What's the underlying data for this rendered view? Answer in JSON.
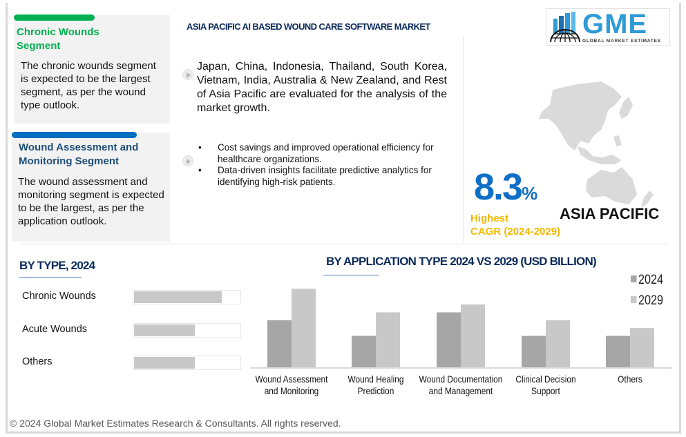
{
  "header": {
    "title": "ASIA PACIFIC AI BASED WOUND CARE SOFTWARE MARKET",
    "logo": {
      "main": "GME",
      "sub": "GLOBAL MARKET ESTIMATES",
      "icon": "globe-buildings-icon"
    }
  },
  "segments": [
    {
      "title": "Chronic Wounds Segment",
      "text": "The chronic wounds segment is expected to be the largest segment, as per the wound type outlook.",
      "accent": "#00b050"
    },
    {
      "title": "Wound Assessment and Monitoring Segment",
      "text": "The wound assessment and monitoring segment is expected to be the largest, as per the application outlook.",
      "accent": "#0070c0"
    }
  ],
  "countries_text": "Japan, China, Indonesia, Thailand, South Korea, Vietnam, India, Australia & New Zealand, and Rest of Asia Pacific are evaluated for the analysis of the market growth.",
  "drivers": [
    "Cost savings and improved operational efficiency for healthcare organizations.",
    "Data-driven insights facilitate predictive analytics for identifying high-risk patients."
  ],
  "cagr": {
    "value": "8.3",
    "unit": "%",
    "label_line1": "Highest",
    "label_line2": "CAGR (2024-2029)",
    "region": "ASIA PACIFIC",
    "color": "#0f6fc6",
    "label_color": "#f5b800"
  },
  "chart_data": [
    {
      "type": "bar",
      "orientation": "horizontal",
      "title": "BY TYPE, 2024",
      "categories": [
        "Chronic Wounds",
        "Acute Wounds",
        "Others"
      ],
      "values": [
        82,
        57,
        57
      ],
      "unit": "relative share (%, estimated from bar fill)",
      "xlim": [
        0,
        100
      ],
      "grid": false
    },
    {
      "type": "bar",
      "title": "BY APPLICATION TYPE 2024 VS 2029 (USD BILLION)",
      "categories": [
        "Wound Assessment and Monitoring",
        "Wound Healing Prediction",
        "Wound Documentation and Management",
        "Clinical Decision Support",
        "Others"
      ],
      "series": [
        {
          "name": "2024",
          "color": "#a6a6a6",
          "values": [
            6,
            4,
            7,
            4,
            4
          ]
        },
        {
          "name": "2029",
          "color": "#c8c8c8",
          "values": [
            10,
            7,
            8,
            6,
            5
          ]
        }
      ],
      "xlabel": "",
      "ylabel": "",
      "ylim": [
        0,
        11
      ],
      "grid": false,
      "legend": "top-right",
      "note": "values in relative units; no axis ticks shown"
    }
  ],
  "footer": "© 2024 Global Market Estimates Research & Consultants. All rights reserved."
}
